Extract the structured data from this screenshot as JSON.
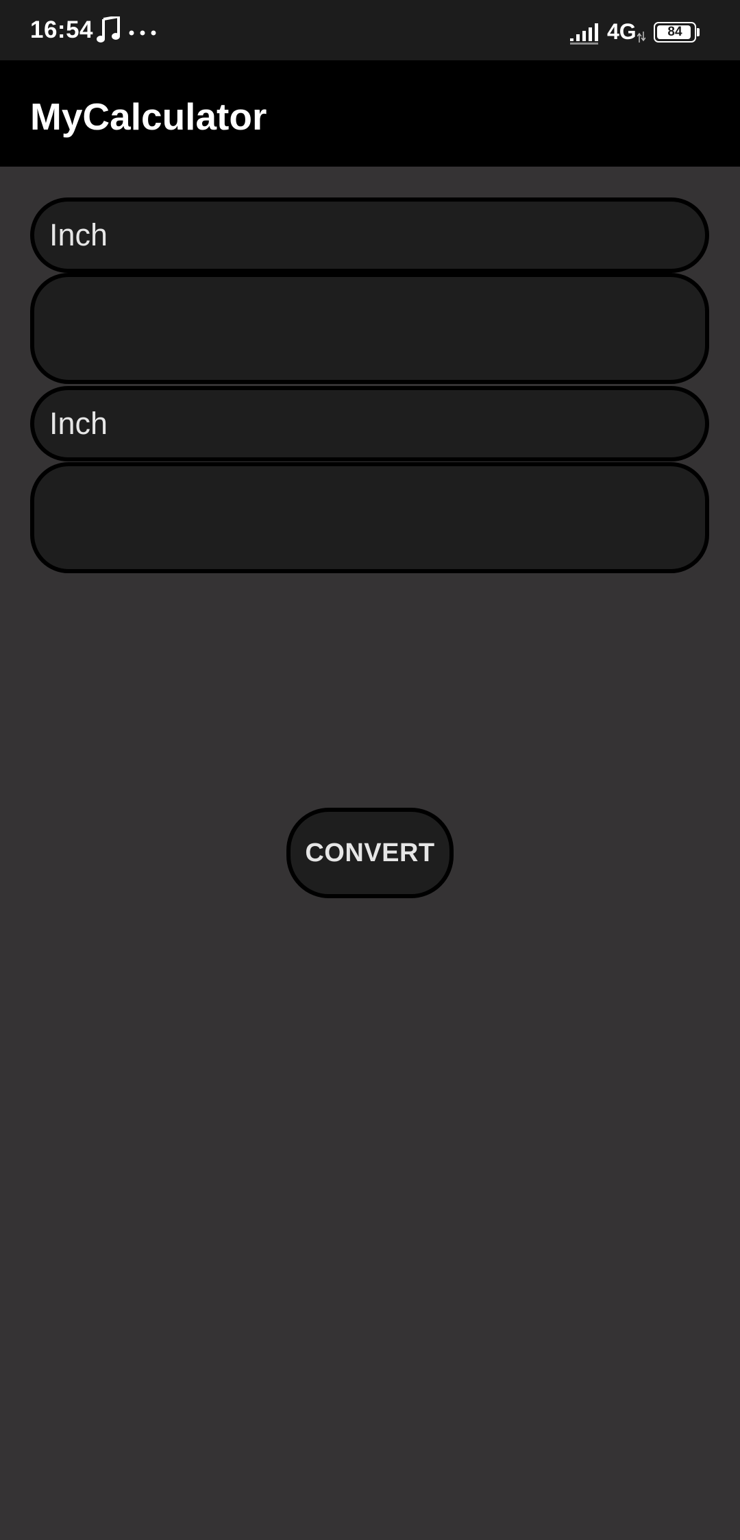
{
  "status_bar": {
    "time": "16:54",
    "network": "4G",
    "battery_level": "84"
  },
  "app_bar": {
    "title": "MyCalculator"
  },
  "converter": {
    "from_unit": "Inch",
    "from_value": "",
    "to_unit": "Inch",
    "to_value": "",
    "convert_label": "CONVERT"
  },
  "colors": {
    "background": "#353334",
    "status_bar": "#1c1c1c",
    "app_bar": "#000000",
    "field_fill": "#1e1e1e",
    "field_border": "#000000",
    "text": "#e6e6e6"
  },
  "icons": [
    "music-note-icon",
    "more-dots-icon",
    "signal-icon",
    "data-arrows-icon",
    "battery-icon"
  ]
}
